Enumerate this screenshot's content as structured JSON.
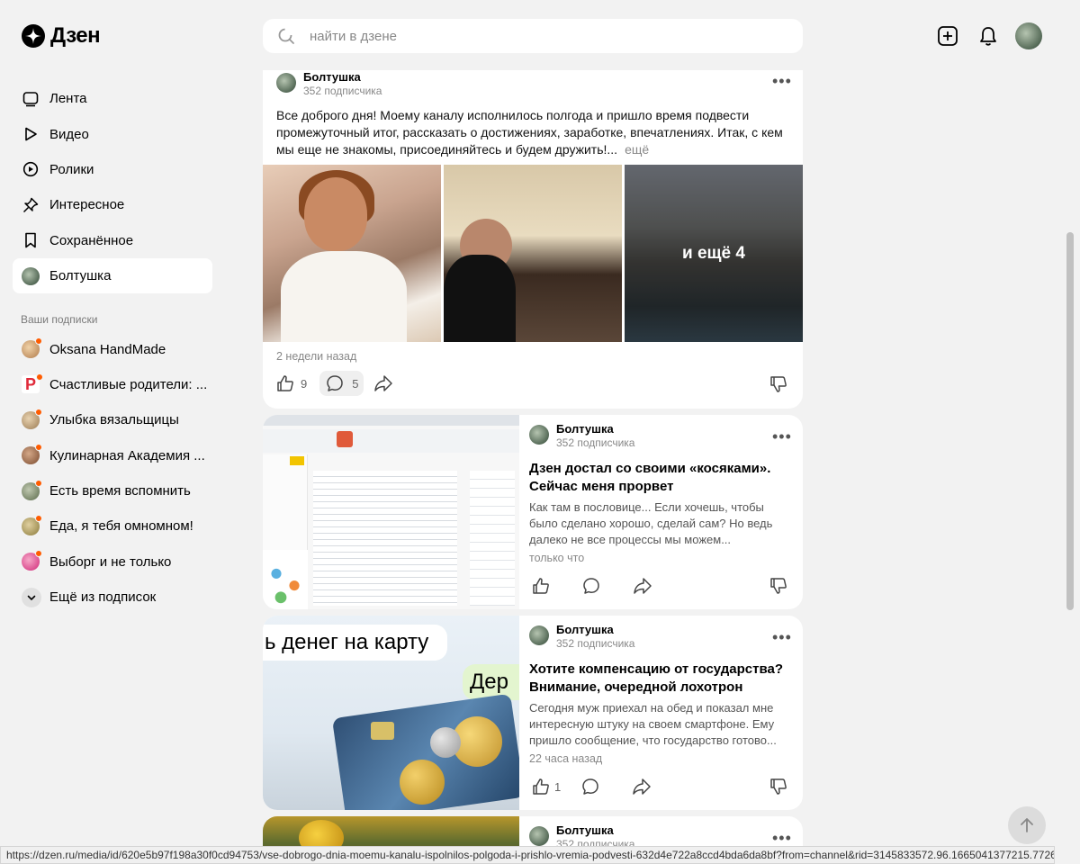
{
  "header": {
    "logo_text": "Дзен",
    "search_placeholder": "найти в дзене"
  },
  "sidebar": {
    "nav": [
      {
        "label": "Лента"
      },
      {
        "label": "Видео"
      },
      {
        "label": "Ролики"
      },
      {
        "label": "Интересное"
      },
      {
        "label": "Сохранённое"
      },
      {
        "label": "Болтушка"
      }
    ],
    "subscriptions_title": "Ваши подписки",
    "subscriptions": [
      {
        "label": "Oksana HandMade",
        "color": "#e0b07a"
      },
      {
        "label": "Счастливые родители: ...",
        "color": "#e02a3a"
      },
      {
        "label": "Улыбка вязальщицы",
        "color": "#c7a57a"
      },
      {
        "label": "Кулинарная Академия ...",
        "color": "#a06a4a"
      },
      {
        "label": "Есть время вспомнить",
        "color": "#7a8a6a"
      },
      {
        "label": "Еда, я тебя омномном!",
        "color": "#b8a068"
      },
      {
        "label": "Выборг и не только",
        "color": "#e0408a"
      }
    ],
    "more_label": "Ещё из подписок"
  },
  "feed": {
    "post": {
      "channel": "Болтушка",
      "subscribers": "352 подписчика",
      "text": "Все доброго дня! Моему каналу исполнилось полгода и пришло время подвести промежуточный итог, рассказать о достижениях, заработке, впечатлениях. Итак, с кем мы еще не знакомы, присоединяйтесь и будем дружить!...",
      "more_link": "ещё",
      "gallery_more": "и ещё 4",
      "time": "2 недели назад",
      "likes": "9",
      "comments": "5"
    },
    "articles": [
      {
        "channel": "Болтушка",
        "subscribers": "352 подписчика",
        "title": "Дзен достал со своими «косяками». Сейчас меня прорвет",
        "snippet": "Как там в пословице... Если хочешь, чтобы было сделано хорошо, сделай сам? Но ведь далеко не все процессы мы можем...",
        "time": "только что",
        "likes": ""
      },
      {
        "channel": "Болтушка",
        "subscribers": "352 подписчика",
        "title": "Хотите компенсацию от государства? Внимание, очередной лохотрон",
        "snippet": "Сегодня муж приехал на обед и показал мне интересную штуку на своем смартфоне. Ему пришло сообщение, что государство готово...",
        "time": "22 часа назад",
        "likes": "1",
        "thumb_text_1": "ь денег на карту",
        "thumb_text_2": "Дер"
      },
      {
        "channel": "Болтушка",
        "subscribers": "352 подписчика"
      }
    ]
  },
  "status_url": "https://dzen.ru/media/id/620e5b97f198a30f0cd94753/vse-dobrogo-dnia-moemu-kanalu-ispolnilos-polgoda-i-prishlo-vremia-podvesti-632d4e722a8ccd4bda6da8bf?from=channel&rid=3145833572.96.1665041377215.77268&place..."
}
